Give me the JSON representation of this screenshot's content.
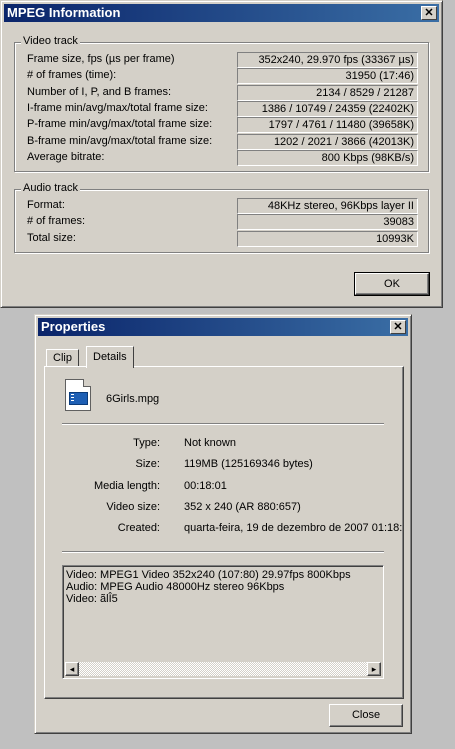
{
  "mpeg_window": {
    "title": "MPEG Information",
    "close_glyph": "✕",
    "video_group": "Video track",
    "video_rows": [
      {
        "label": "Frame size, fps (µs per frame)",
        "value": "352x240, 29.970 fps (33367 µs)"
      },
      {
        "label": "# of frames (time):",
        "value": "31950 (17:46)"
      },
      {
        "label": "Number of I, P, and B frames:",
        "value": "2134 / 8529 / 21287"
      },
      {
        "label": "I-frame min/avg/max/total frame size:",
        "value": "1386 / 10749 / 24359 (22402K)"
      },
      {
        "label": "P-frame min/avg/max/total frame size:",
        "value": "1797 / 4761 / 11480 (39658K)"
      },
      {
        "label": "B-frame min/avg/max/total frame size:",
        "value": "1202 / 2021 / 3866 (42013K)"
      },
      {
        "label": "Average bitrate:",
        "value": "800 Kbps (98KB/s)"
      }
    ],
    "audio_group": "Audio track",
    "audio_rows": [
      {
        "label": "Format:",
        "value": "48KHz stereo, 96Kbps layer II"
      },
      {
        "label": "# of frames:",
        "value": "39083"
      },
      {
        "label": "Total size:",
        "value": "10993K"
      }
    ],
    "ok_label": "OK"
  },
  "properties_window": {
    "title": "Properties",
    "close_glyph": "✕",
    "tabs": [
      "Clip",
      "Details"
    ],
    "filename": "6Girls.mpg",
    "props": [
      {
        "key": "Type:",
        "value": "Not known"
      },
      {
        "key": "Size:",
        "value": "119MB (125169346 bytes)"
      },
      {
        "key": "Media length:",
        "value": "00:18:01"
      },
      {
        "key": "Video size:",
        "value": "352 x 240 (AR 880:657)"
      },
      {
        "key": "Created:",
        "value": "quarta-feira, 19 de dezembro de 2007 01:18:"
      }
    ],
    "details_lines": [
      "Video: MPEG1 Video 352x240 (107:80) 29.97fps 800Kbps",
      "Audio: MPEG Audio 48000Hz stereo 96Kbps",
      "Video: ãlÎ5"
    ],
    "close_label": "Close",
    "scroll_left": "◂",
    "scroll_right": "▸"
  }
}
